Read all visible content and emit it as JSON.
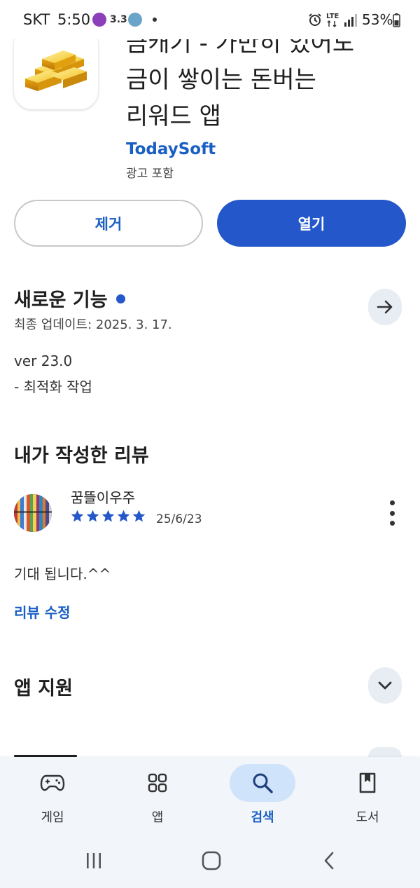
{
  "status_bar": {
    "carrier": "SKT",
    "time": "5:50",
    "badge_text": "3.3",
    "battery": "53%"
  },
  "app": {
    "title": "금캐기 - 가만히 있어도 금이 쌓이는 돈버는 리워드 앱",
    "title_lines": [
      "금캐기 - 가만히 있어도",
      "금이 쌓이는 돈버는",
      "리워드 앱"
    ],
    "developer": "TodaySoft",
    "ad_note": "광고 포함"
  },
  "actions": {
    "remove_label": "제거",
    "open_label": "열기"
  },
  "whats_new": {
    "title": "새로운 기능",
    "updated": "최종 업데이트: 2025. 3. 17.",
    "version": "ver 23.0",
    "note": "- 최적화 작업"
  },
  "my_review": {
    "title": "내가 작성한 리뷰",
    "reviewer": "꿈뜰이우주",
    "rating": 5,
    "date": "25/6/23",
    "text": "기대 됩니다.^^",
    "edit_label": "리뷰 수정"
  },
  "app_support": {
    "title": "앱 지원"
  },
  "bottom_nav": {
    "items": [
      {
        "label": "게임",
        "icon": "gamepad-icon",
        "active": false
      },
      {
        "label": "앱",
        "icon": "apps-grid-icon",
        "active": false
      },
      {
        "label": "검색",
        "icon": "search-icon",
        "active": true
      },
      {
        "label": "도서",
        "icon": "book-icon",
        "active": false
      }
    ]
  },
  "colors": {
    "accent": "#2457c9",
    "link": "#1a5fc4",
    "nav_background": "#f2f5fa",
    "active_pill": "#cfe3fb"
  }
}
